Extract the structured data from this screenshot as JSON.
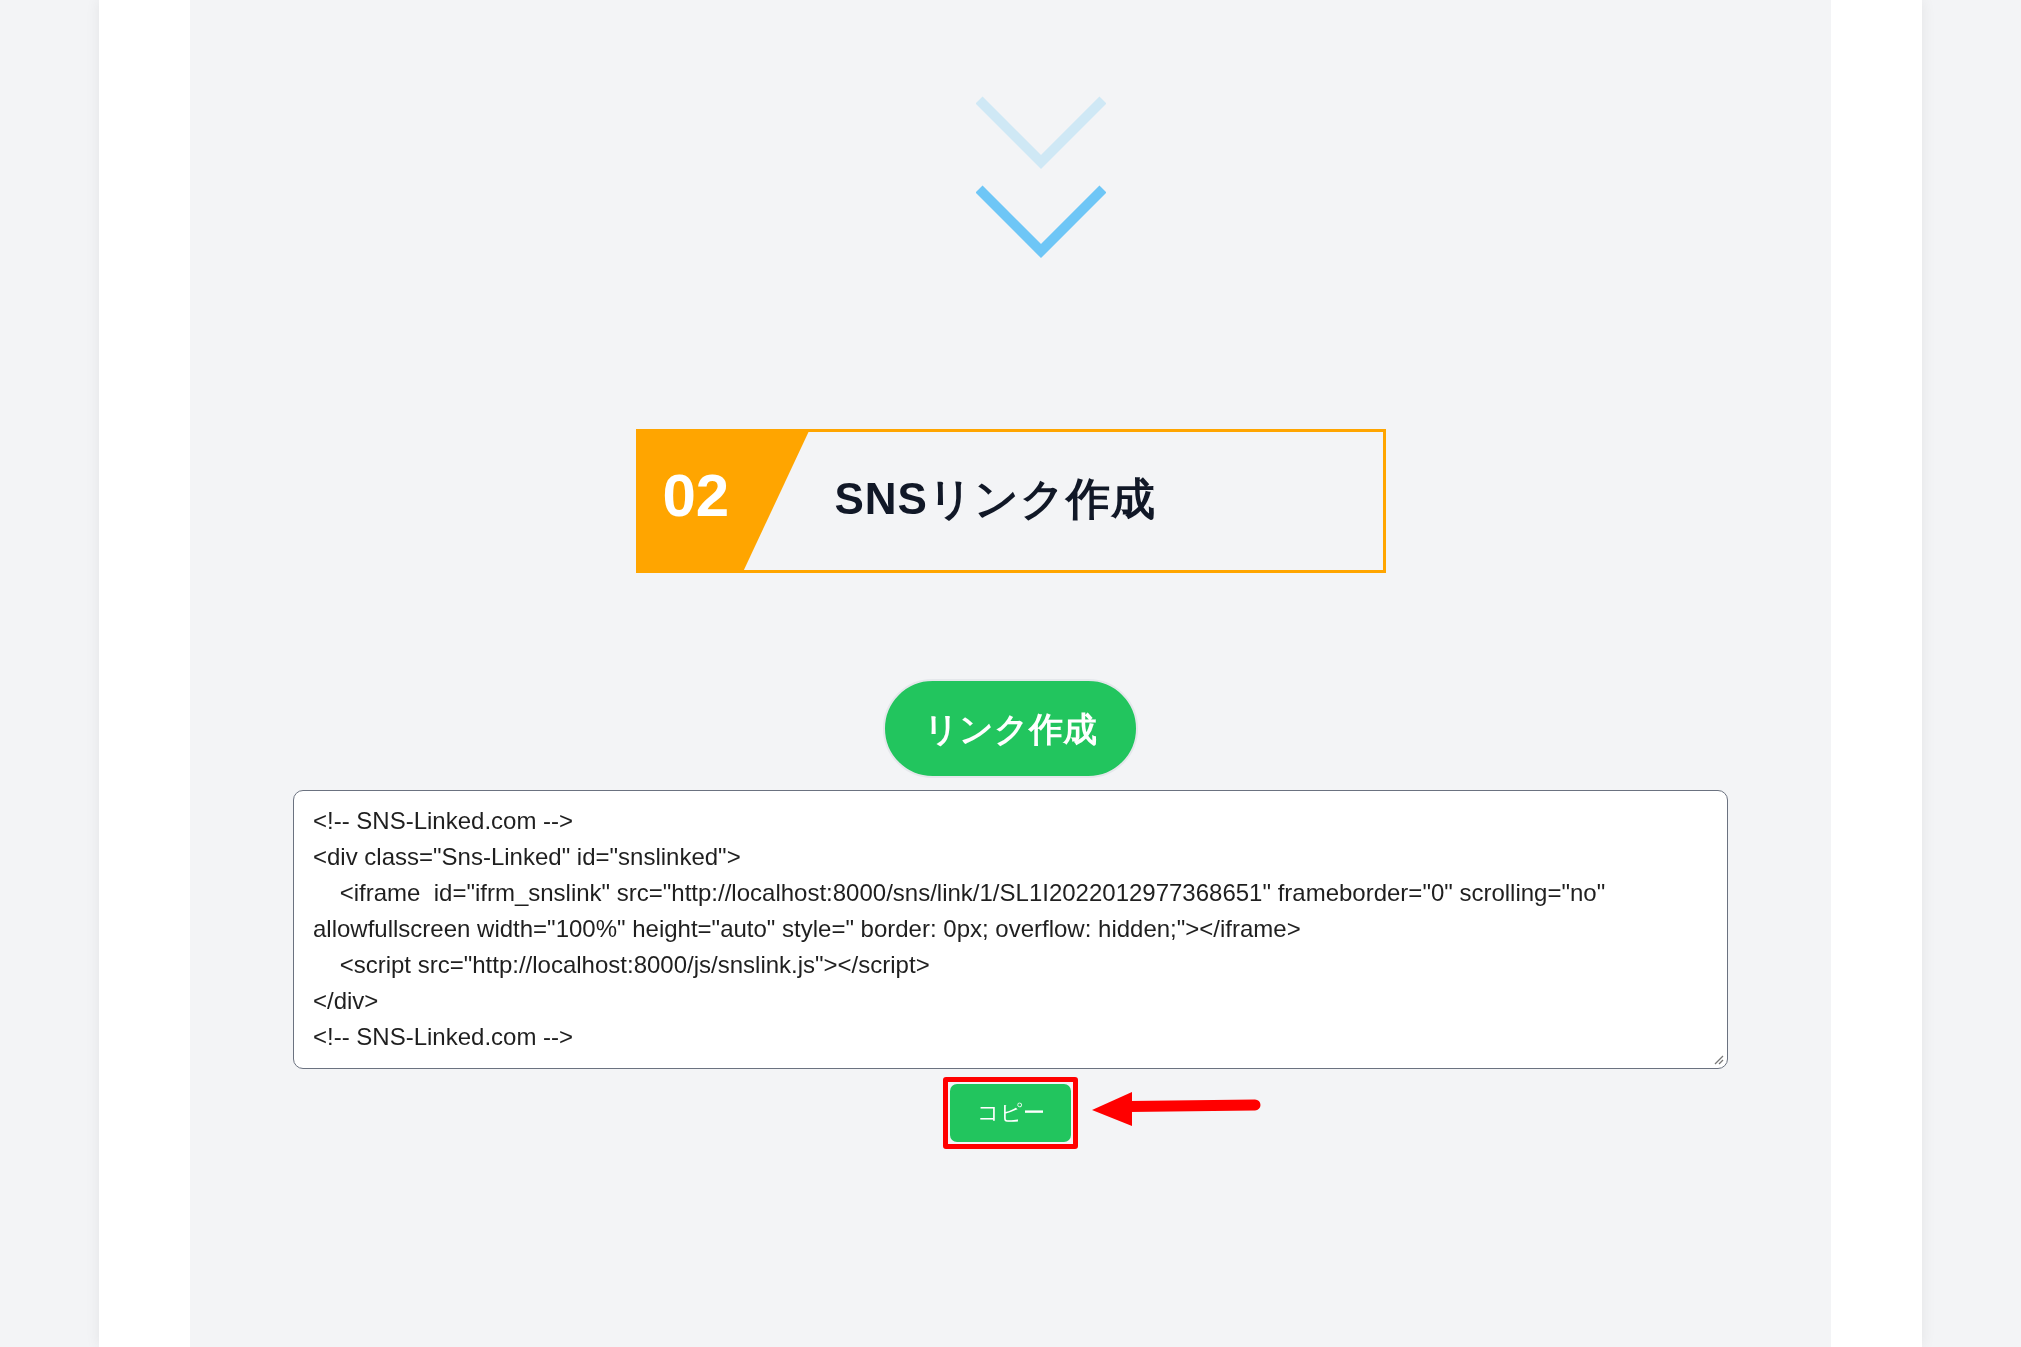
{
  "section": {
    "number": "02",
    "title": "SNSリンク作成"
  },
  "create_button": {
    "label": "リンク作成"
  },
  "embed_code": {
    "lines": [
      "<!-- SNS-Linked.com -->",
      "<div class=\"Sns-Linked\" id=\"snslinked\">",
      "    <iframe  id=\"ifrm_snslink\" src=\"http://localhost:8000/sns/link/1/SL1I2022012977368651\" frameborder=\"0\" scrolling=\"no\" allowfullscreen width=\"100%\" height=\"auto\" style=\" border: 0px; overflow: hidden;\"></iframe>",
      "    <script src=\"http://localhost:8000/js/snslink.js\"></script>",
      "</div>",
      "<!-- SNS-Linked.com -->"
    ]
  },
  "copy_button": {
    "label": "コピー"
  }
}
